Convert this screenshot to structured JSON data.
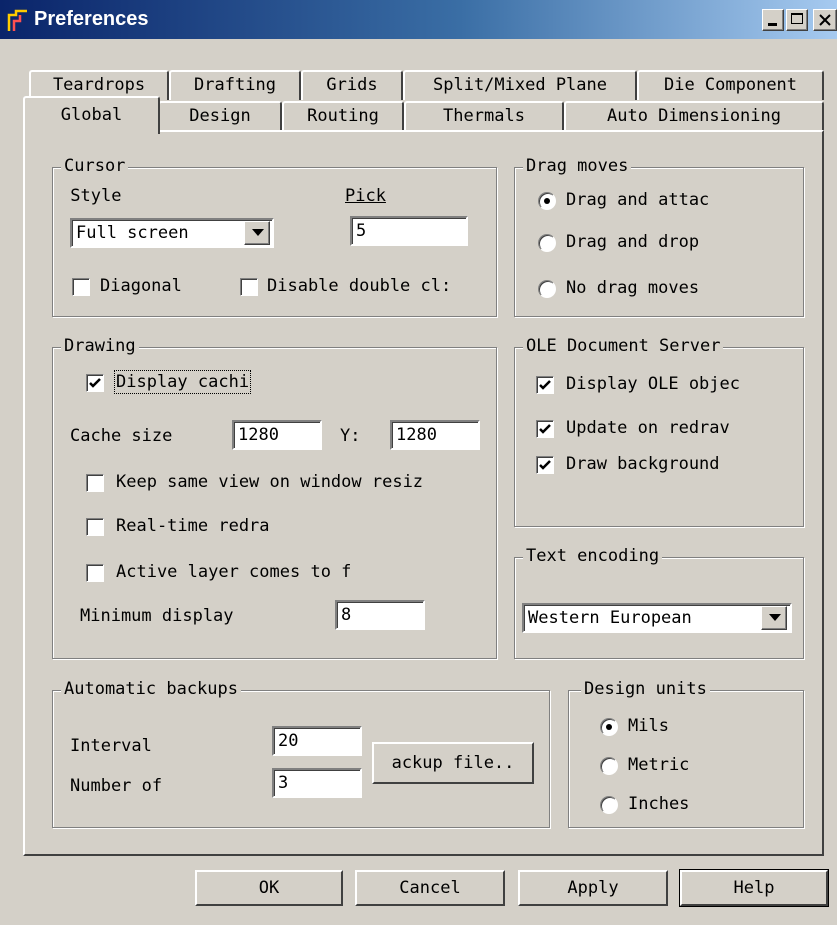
{
  "window": {
    "title": "Preferences"
  },
  "tabs": {
    "row_back": [
      "Teardrops",
      "Drafting",
      "Grids",
      "Split/Mixed Plane",
      "Die Component"
    ],
    "row_front": [
      "Global",
      "Design",
      "Routing",
      "Thermals",
      "Auto Dimensioning"
    ],
    "active": "Global"
  },
  "cursor": {
    "legend": "Cursor",
    "style_label": "Style",
    "style_value": "Full screen",
    "pick_label": "Pick",
    "pick_value": "5",
    "diagonal_label": "Diagonal",
    "diagonal_checked": false,
    "disable_dbl_label": "Disable double cl:",
    "disable_dbl_checked": false
  },
  "drag_moves": {
    "legend": "Drag moves",
    "options": [
      "Drag and attac",
      "Drag and drop",
      "No drag moves"
    ],
    "selected": "Drag and attac"
  },
  "drawing": {
    "legend": "Drawing",
    "display_caching_label": "Display cachi",
    "display_caching_checked": true,
    "cache_size_label": "Cache size",
    "cache_x_value": "1280",
    "y_label": "Y:",
    "cache_y_value": "1280",
    "keep_view_label": "Keep same view on window resiz",
    "keep_view_checked": false,
    "realtime_label": "Real-time redra",
    "realtime_checked": false,
    "active_layer_label": "Active layer comes to f",
    "active_layer_checked": false,
    "min_display_label": "Minimum display",
    "min_display_value": "8"
  },
  "ole": {
    "legend": "OLE Document Server",
    "display_ole_label": "Display OLE objec",
    "display_ole_checked": true,
    "update_redraw_label": "Update on redrav",
    "update_redraw_checked": true,
    "draw_bg_label": "Draw background",
    "draw_bg_checked": true
  },
  "text_encoding": {
    "legend": "Text encoding",
    "value": "Western European"
  },
  "backups": {
    "legend": "Automatic backups",
    "interval_label": "Interval",
    "interval_value": "20",
    "number_label": "Number of",
    "number_value": "3",
    "backup_file_button": "ackup file.."
  },
  "design_units": {
    "legend": "Design units",
    "options": [
      "Mils",
      "Metric",
      "Inches"
    ],
    "selected": "Mils"
  },
  "buttons": {
    "ok": "OK",
    "cancel": "Cancel",
    "apply": "Apply",
    "help": "Help"
  },
  "icons": {
    "app": "padslogic-icon",
    "minimize": "minimize-icon",
    "maximize": "maximize-icon",
    "close": "close-icon"
  },
  "colors": {
    "face": "#d4d0c8",
    "title_start": "#0a246a",
    "title_end": "#a6caf0",
    "title_text": "#ffffff"
  }
}
